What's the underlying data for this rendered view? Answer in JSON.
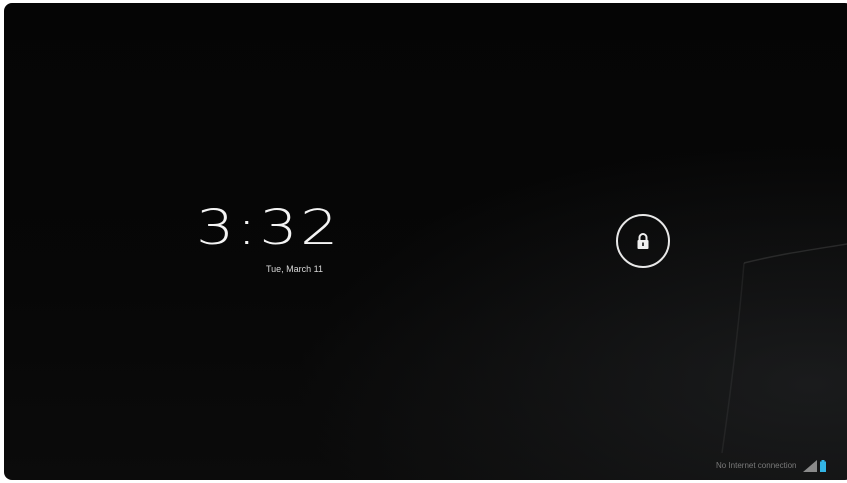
{
  "lockscreen": {
    "time": "3:32",
    "date": "Tue, March 11"
  },
  "lock_button": {
    "icon": "lock-icon"
  },
  "status_bar": {
    "connection_text": "No Internet connection",
    "signal_icon": "signal-icon",
    "battery_icon": "battery-icon"
  },
  "colors": {
    "background": "#050505",
    "foreground": "#f4f4f4",
    "status_text": "#7a7a7a",
    "battery_accent": "#33b5e5"
  }
}
